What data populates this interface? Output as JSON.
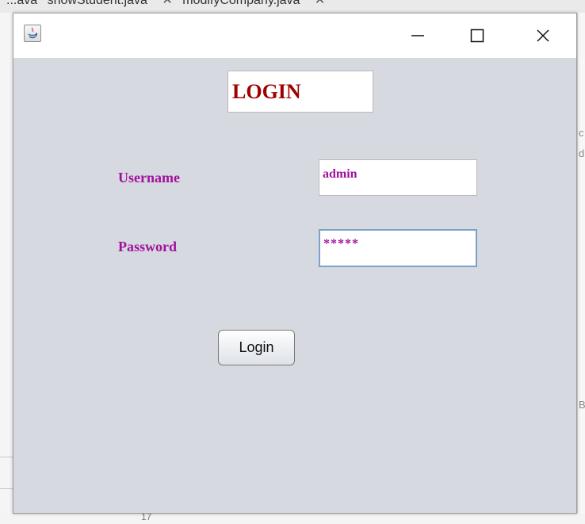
{
  "background_ide": {
    "tabs": [
      {
        "label": "...ava",
        "close": "✕"
      },
      {
        "label": "showStudent.java",
        "close": "✕"
      },
      {
        "label": "modifyCompany.java",
        "close": "✕"
      }
    ],
    "right_fragments": [
      "c",
      "d",
      "B"
    ],
    "bottom_fragment": "17"
  },
  "window": {
    "title": "",
    "icon": "java-app-icon",
    "controls": {
      "minimize": "minimize-icon",
      "maximize": "maximize-icon",
      "close": "close-icon"
    }
  },
  "form": {
    "heading": "LOGIN",
    "username_label": "Username",
    "username_value": "admin",
    "password_label": "Password",
    "password_value": "*****",
    "login_button": "Login"
  },
  "colors": {
    "window_bg": "#d6d9e0",
    "heading": "#a00000",
    "label": "#a0119e",
    "focus_border": "#7ba2c9"
  }
}
